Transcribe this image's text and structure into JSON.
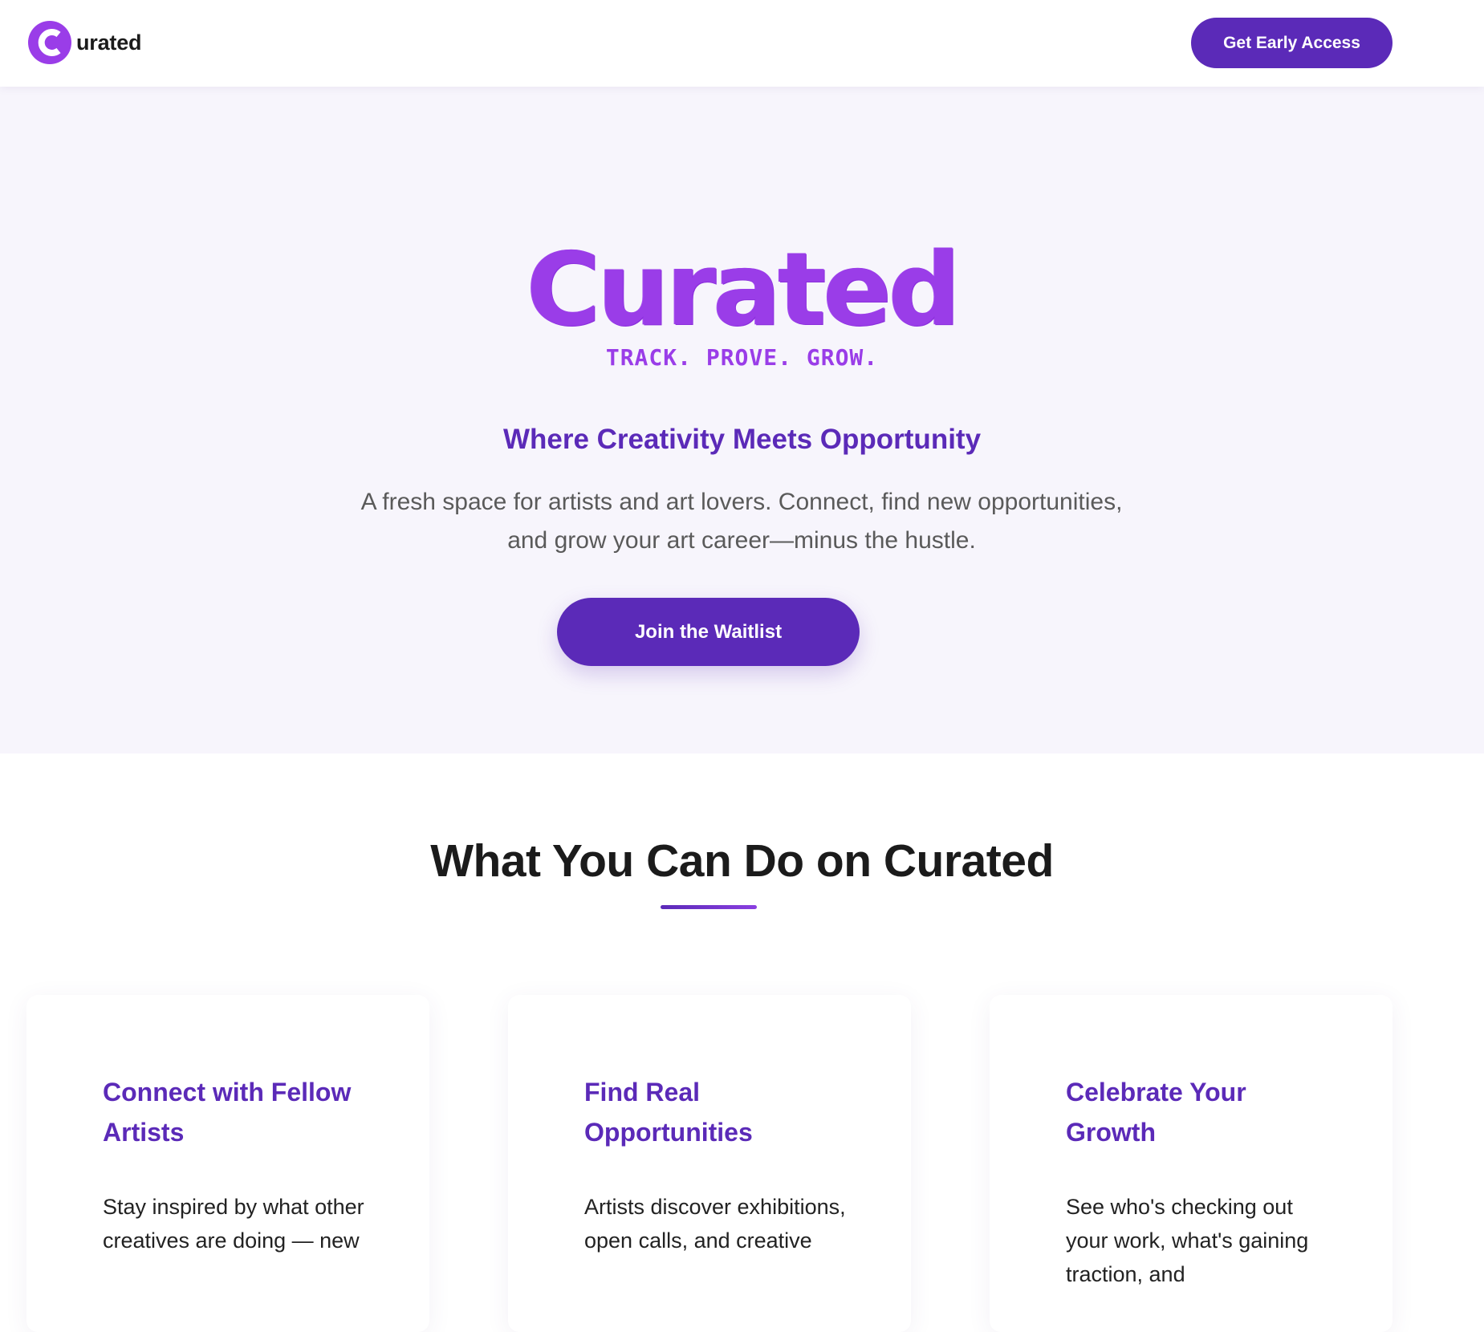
{
  "header": {
    "brand_word": "urated",
    "cta_label": "Get Early Access"
  },
  "hero": {
    "logo_word": "Curated",
    "logo_tagline": "TRACK. PROVE. GROW.",
    "heading": "Where Creativity Meets Opportunity",
    "description": "A fresh space for artists and art lovers. Connect, find new opportunities, and grow your art career—minus the hustle.",
    "cta_label": "Join the Waitlist"
  },
  "features": {
    "title": "What You Can Do on Curated",
    "cards": [
      {
        "title": "Connect with Fellow Artists",
        "body": "Stay inspired by what other creatives are doing — new"
      },
      {
        "title": "Find Real Opportunities",
        "body": "Artists discover exhibitions, open calls, and creative"
      },
      {
        "title": "Celebrate Your Growth",
        "body": "See who's checking out your work, what's gaining traction, and"
      }
    ]
  },
  "colors": {
    "brand_purple": "#5b2ab8",
    "logo_purple": "#9a3de8",
    "hero_background": "#f7f5fc"
  }
}
